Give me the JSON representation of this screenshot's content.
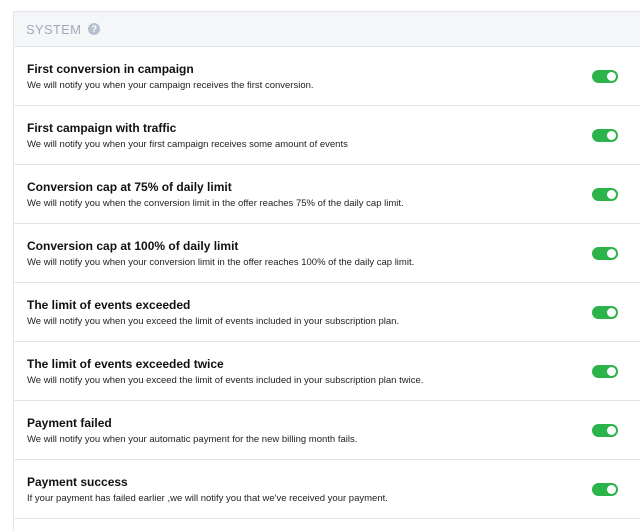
{
  "section": {
    "title": "SYSTEM",
    "help_icon": "?"
  },
  "colors": {
    "toggle_on": "#2cb34a",
    "header_bg": "#f5f6f8",
    "header_text": "#a2aabb"
  },
  "notifications": [
    {
      "title": "First conversion in campaign",
      "description": "We will notify you when your campaign receives the first conversion.",
      "enabled": true
    },
    {
      "title": "First campaign with traffic",
      "description": "We will notify you when your first campaign receives some amount of events",
      "enabled": true
    },
    {
      "title": "Conversion cap at 75% of daily limit",
      "description": "We will notify you when the conversion limit in the offer reaches 75% of the daily cap limit.",
      "enabled": true
    },
    {
      "title": "Conversion cap at 100% of daily limit",
      "description": "We will notify you when your conversion limit in the offer reaches 100% of the daily cap limit.",
      "enabled": true
    },
    {
      "title": "The limit of events exceeded",
      "description": "We will notify you when you exceed the limit of events included in your subscription plan.",
      "enabled": true
    },
    {
      "title": "The limit of events exceeded twice",
      "description": "We will notify you when you exceed the limit of events included in your subscription plan twice.",
      "enabled": true
    },
    {
      "title": "Payment failed",
      "description": "We will notify you when your automatic payment for the new billing month fails.",
      "enabled": true
    },
    {
      "title": "Payment success",
      "description": "If your payment has failed earlier ,we will notify you that we've received your payment.",
      "enabled": true
    }
  ]
}
